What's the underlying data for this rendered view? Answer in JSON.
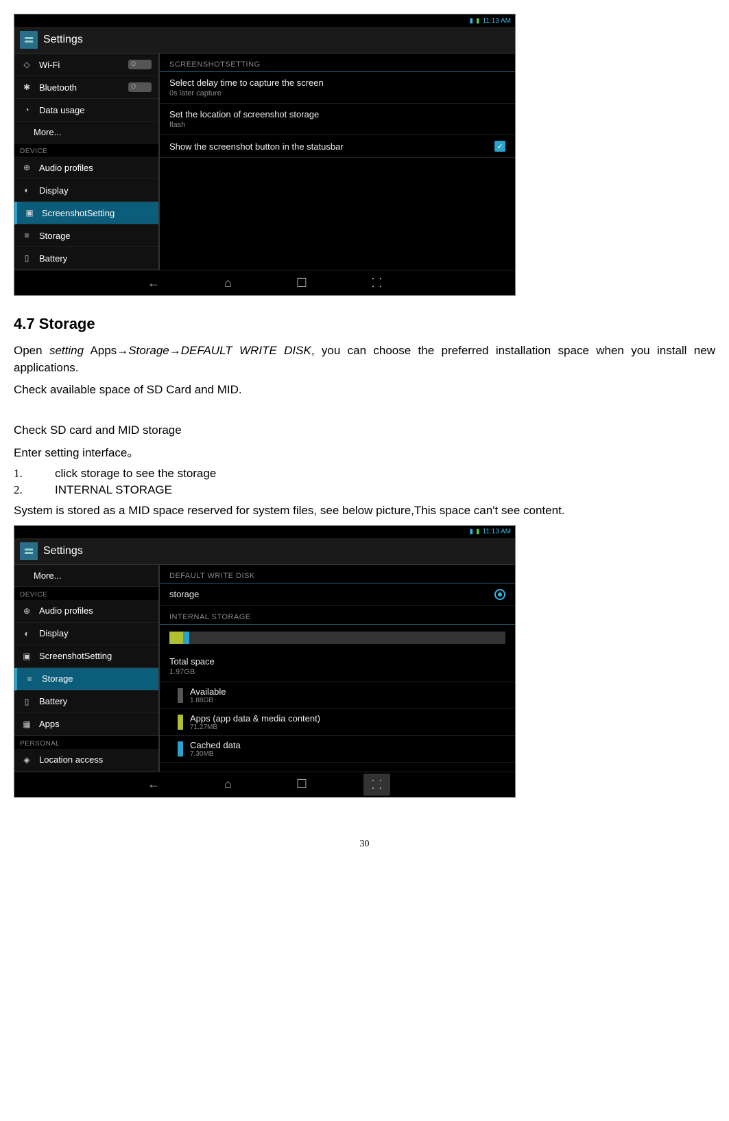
{
  "statusbar_time": "11:13 AM",
  "app_title": "Settings",
  "shot1": {
    "side": {
      "wifi": "Wi-Fi",
      "bluetooth": "Bluetooth",
      "data_usage": "Data usage",
      "more": "More...",
      "device_header": "DEVICE",
      "audio": "Audio profiles",
      "display": "Display",
      "screenshot": "ScreenshotSetting",
      "storage": "Storage",
      "battery": "Battery"
    },
    "detail": {
      "header": "SCREENSHOTSETTING",
      "delay_title": "Select delay time to capture the screen",
      "delay_sub": "0s later capture",
      "loc_title": "Set the location of screenshot storage",
      "loc_sub": "flash",
      "show_title": "Show the screenshot button in the statusbar"
    }
  },
  "heading": "4.7 Storage",
  "para1_a": "Open  ",
  "para1_b_i": "setting",
  "para1_c": "  Apps",
  "para1_d_i": "Storage",
  "para1_e_i": "DEFAULT  WRITE  DISK",
  "para1_f": ",  you  can  choose  the  preferred installation space when you install new applications.",
  "para2": "Check available space of SD Card and MID.",
  "para3": "Check SD card and MID storage",
  "para4": "Enter setting interface。",
  "list1": "click storage to see the storage",
  "list2": "INTERNAL STORAGE",
  "para5": "System is stored as a MID space reserved for system files, see below picture,This space can't see content.",
  "shot2": {
    "side": {
      "more": "More...",
      "device_header": "DEVICE",
      "audio": "Audio profiles",
      "display": "Display",
      "screenshot": "ScreenshotSetting",
      "storage": "Storage",
      "battery": "Battery",
      "apps": "Apps",
      "personal_header": "PERSONAL",
      "location": "Location access"
    },
    "detail": {
      "header1": "DEFAULT WRITE DISK",
      "radio_label": "storage",
      "header2": "INTERNAL STORAGE",
      "total_t": "Total space",
      "total_s": "1.97GB",
      "avail_t": "Available",
      "avail_s": "1.88GB",
      "apps_t": "Apps (app data & media content)",
      "apps_s": "71.27MB",
      "cached_t": "Cached data",
      "cached_s": "7.30MB"
    }
  },
  "page_number": "30"
}
